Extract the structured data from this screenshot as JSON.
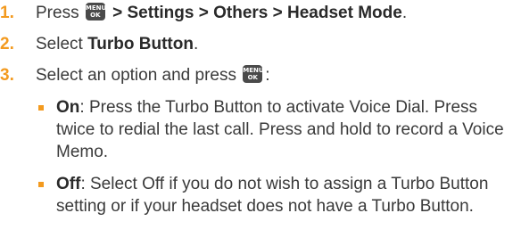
{
  "steps": [
    {
      "number": "1.",
      "pre_text": "Press ",
      "key": {
        "line1": "MENU",
        "line2": "OK"
      },
      "bold_text": " > Settings > Others > Headset Mode",
      "post_text": "."
    },
    {
      "number": "2.",
      "pre_text": "Select ",
      "bold_text": "Turbo Button",
      "post_text": "."
    },
    {
      "number": "3.",
      "pre_text": "Select an option and press ",
      "key": {
        "line1": "MENU",
        "line2": "OK"
      },
      "post_text": ":"
    }
  ],
  "options": [
    {
      "title": "On",
      "text": ": Press the Turbo Button to activate Voice Dial. Press twice to redial the last call. Press and hold to record a Voice Memo."
    },
    {
      "title": "Off",
      "text": ": Select Off if you do not wish to assign a Turbo Button setting or if your headset does not have a Turbo Button."
    }
  ],
  "colors": {
    "accent": "#f39a1f",
    "text": "#3a3a3a",
    "key_bg": "#4a4a4a"
  }
}
